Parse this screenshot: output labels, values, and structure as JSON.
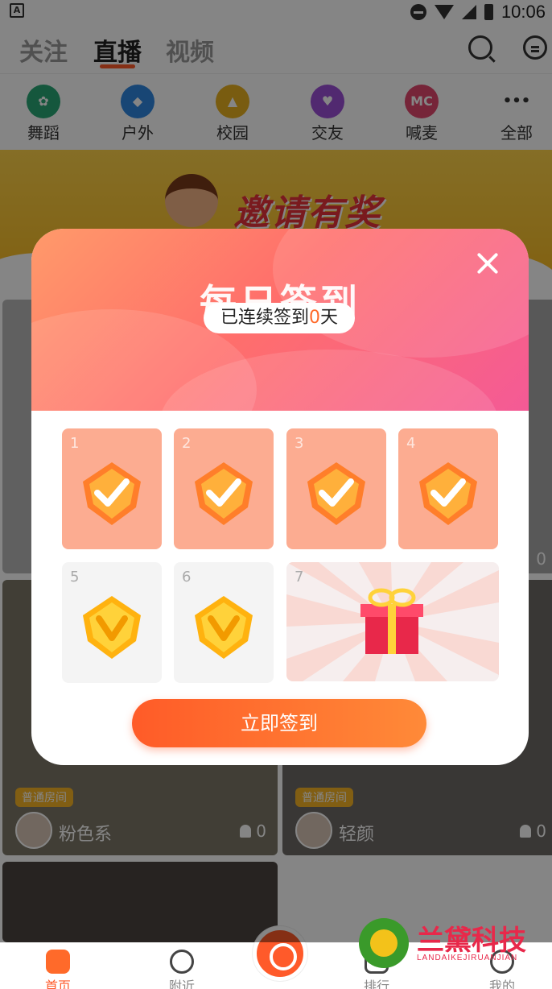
{
  "status_bar": {
    "time": "10:06",
    "left_icon": "A"
  },
  "header": {
    "tabs": [
      {
        "label": "关注"
      },
      {
        "label": "直播",
        "active": true
      },
      {
        "label": "视频"
      }
    ],
    "icons": [
      "search-icon",
      "message-icon"
    ]
  },
  "categories": [
    {
      "label": "舞蹈",
      "icon": "dance-icon",
      "color": "#2aa876"
    },
    {
      "label": "户外",
      "icon": "outdoor-icon",
      "color": "#2f86e0"
    },
    {
      "label": "校园",
      "icon": "campus-icon",
      "color": "#e9b020"
    },
    {
      "label": "交友",
      "icon": "heart-icon",
      "color": "#9b4fd6"
    },
    {
      "label": "喊麦",
      "icon_text": "MC",
      "icon": "mic-icon",
      "color": "#e2486e"
    },
    {
      "label": "全部",
      "icon_text": "•••",
      "icon": "more-icon",
      "color": "#ffffff"
    }
  ],
  "banner": {
    "title": "邀请有奖"
  },
  "rooms": [
    {
      "badge": "普通房间",
      "name": "粉色系",
      "viewers": "0"
    },
    {
      "badge": "普通房间",
      "name": "轻颜",
      "viewers": "0"
    },
    {
      "viewers": "0"
    }
  ],
  "bottom_nav": [
    {
      "label": "首页",
      "active": true
    },
    {
      "label": "附近"
    },
    {
      "label": "排行"
    },
    {
      "label": "我的"
    }
  ],
  "checkin_modal": {
    "title": "每日签到",
    "streak_prefix": "已连续签到",
    "streak_count": "0",
    "streak_suffix": "天",
    "days": [
      {
        "num": "1",
        "state": "checked"
      },
      {
        "num": "2",
        "state": "checked"
      },
      {
        "num": "3",
        "state": "checked"
      },
      {
        "num": "4",
        "state": "checked"
      },
      {
        "num": "5",
        "state": "pending"
      },
      {
        "num": "6",
        "state": "pending"
      },
      {
        "num": "7",
        "state": "gift"
      }
    ],
    "button_label": "立即签到"
  },
  "watermark": {
    "title": "兰黛科技",
    "subtitle": "LANDAIKEJIRUANJIAN"
  },
  "colors": {
    "accent": "#ff5a2a",
    "checked_tile": "#fcac91",
    "badge": "#f7b425"
  }
}
